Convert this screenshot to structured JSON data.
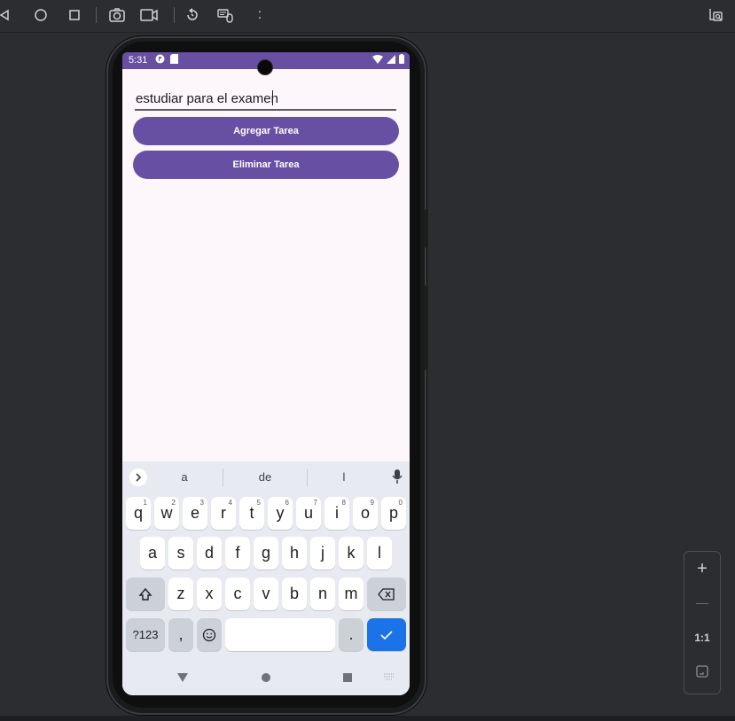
{
  "toolbar": {
    "icons": [
      "back-icon",
      "home-icon",
      "overview-icon",
      "screenshot-icon",
      "screenrecord-icon",
      "rotate-icon",
      "keyboard-mouse-icon",
      "more-icon",
      "device-inspect-icon"
    ],
    "more_label": ":"
  },
  "status_bar": {
    "time": "5:31",
    "color": "#6750a4"
  },
  "app": {
    "task_input_value": "estudiar para el examen",
    "add_button_label": "Agregar Tarea",
    "delete_button_label": "Eliminar Tarea",
    "accent_color": "#6750a4"
  },
  "keyboard": {
    "suggestions": [
      "a",
      "de",
      "l"
    ],
    "row1": [
      {
        "k": "q",
        "n": "1"
      },
      {
        "k": "w",
        "n": "2"
      },
      {
        "k": "e",
        "n": "3"
      },
      {
        "k": "r",
        "n": "4"
      },
      {
        "k": "t",
        "n": "5"
      },
      {
        "k": "y",
        "n": "6"
      },
      {
        "k": "u",
        "n": "7"
      },
      {
        "k": "i",
        "n": "8"
      },
      {
        "k": "o",
        "n": "9"
      },
      {
        "k": "p",
        "n": "0"
      }
    ],
    "row2": [
      "a",
      "s",
      "d",
      "f",
      "g",
      "h",
      "j",
      "k",
      "l"
    ],
    "row3": [
      "z",
      "x",
      "c",
      "v",
      "b",
      "n",
      "m"
    ],
    "symbols_label": "?123",
    "comma_label": ",",
    "period_label": ".",
    "enter_color": "#1a73e8"
  },
  "zoom": {
    "plus_label": "+",
    "minus_label": "—",
    "one_to_one_label": "1:1"
  }
}
